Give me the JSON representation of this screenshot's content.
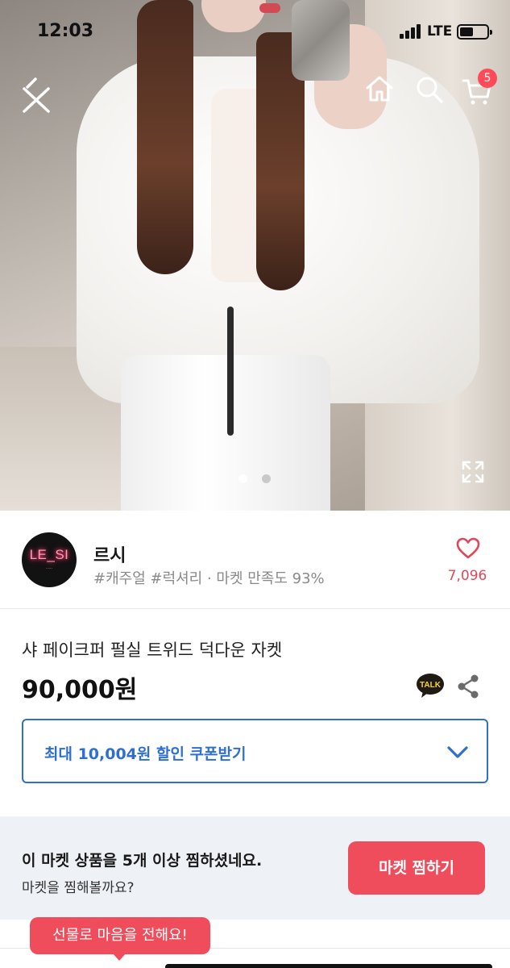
{
  "status_bar": {
    "time": "12:03",
    "network": "LTE"
  },
  "nav": {
    "cart_count": "5"
  },
  "gallery": {
    "page_count": 2,
    "current_page": 1,
    "active_color": "#ffffff",
    "inactive_color": "#c9c9c9"
  },
  "seller": {
    "logo_text": "LE_SI",
    "name": "르시",
    "meta": "#캐주얼 #럭셔리 · 마켓 만족도 93%",
    "likes": "7,096"
  },
  "product": {
    "title": "샤 페이크퍼 펄실 트위드 덕다운 자켓",
    "price": "90,000원",
    "talk_label": "TALK"
  },
  "coupon": {
    "label": "최대 10,004원 할인 쿠폰받기"
  },
  "follow_banner": {
    "title": "이 마켓 상품을 5개 이상 찜하셨네요.",
    "subtitle": "마켓을 찜해볼까요?",
    "button": "마켓 찜하기"
  },
  "gift_tooltip": {
    "label": "선물로 마음을 전해요!"
  },
  "colors": {
    "accent": "#ef4d5b",
    "coupon_blue": "#2f6fd1",
    "like_red": "#e0475a",
    "banner_bg": "#eef1f6"
  },
  "icons": [
    "back-close-icon",
    "home-icon",
    "search-icon",
    "cart-icon",
    "expand-icon",
    "heart-icon",
    "kakao-talk-icon",
    "share-icon",
    "chevron-down-icon"
  ]
}
